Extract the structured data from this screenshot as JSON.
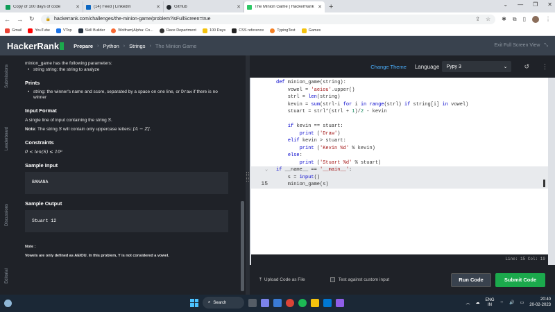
{
  "browser": {
    "tabs": [
      {
        "title": "Copy of 100 days of code",
        "color": "#0f9d58",
        "active": false
      },
      {
        "title": "(14) Feed | LinkedIn",
        "color": "#0a66c2",
        "active": false
      },
      {
        "title": "GitHub",
        "color": "#24292e",
        "active": false
      },
      {
        "title": "The Minion Game | HackerRank",
        "color": "#2ec866",
        "active": true
      }
    ],
    "new_tab": "+",
    "url": "hackerrank.com/challenges/the-minion-game/problem?isFullScreen=true",
    "bookmarks": [
      {
        "label": "Gmail",
        "color": "#ea4335"
      },
      {
        "label": "YouTube",
        "color": "#ff0000"
      },
      {
        "label": "VTop",
        "color": "#1a73e8"
      },
      {
        "label": "Skill Builder",
        "color": "#232f3e"
      },
      {
        "label": "Wolfram|Alpha: Co...",
        "color": "#f96932"
      },
      {
        "label": "Race Department",
        "color": "#333333"
      },
      {
        "label": "100 Days",
        "color": "#f4c20d"
      },
      {
        "label": "CSS reference",
        "color": "#222222"
      },
      {
        "label": "TypingTest",
        "color": "#f48024"
      },
      {
        "label": "Games",
        "color": "#f4c20d"
      }
    ]
  },
  "header": {
    "logo": "HackerRank",
    "crumbs": [
      "Prepare",
      "Python",
      "Strings",
      "The Minion Game"
    ],
    "exit": "Exit Full Screen View"
  },
  "side_tabs": [
    "Submissions",
    "Leaderboard",
    "Discussions",
    "Editorial"
  ],
  "problem": {
    "intro": "minion_game has the following parameters:",
    "param": "string string: the string to analyze",
    "prints_h": "Prints",
    "prints_pre": "string: the winner's name and score, separated by a space on one line, or ",
    "prints_draw": "Draw",
    "prints_post": " if there is no winner",
    "input_h": "Input Format",
    "input_text": "A single line of input containing the string ",
    "input_var": "S.",
    "note_label": "Note",
    "note_text": ": The string ",
    "note_var": "S",
    "note_text2": " will contain only uppercase letters: ",
    "note_range": "[A − Z].",
    "constraints_h": "Constraints",
    "constraint": "0 < len(S) ≤ 10⁶",
    "sample_in_h": "Sample Input",
    "sample_in": "BANANA",
    "sample_out_h": "Sample Output",
    "sample_out": "Stuart 12",
    "footnote_h": "Note :",
    "footnote": "Vowels are only defined as AEIOU. In this problem, Y is not considered a vowel."
  },
  "editor_top": {
    "change_theme": "Change Theme",
    "language_label": "Language",
    "language_value": "Pypy 3"
  },
  "code": {
    "current_line_number": "15",
    "status": "Line: 15 Col: 19"
  },
  "footer": {
    "upload": "Upload Code as File",
    "custom_input": "Test against custom input",
    "run": "Run Code",
    "submit": "Submit Code"
  },
  "taskbar": {
    "search": "Search",
    "lang": "ENG",
    "region": "IN",
    "time": "20:40",
    "date": "20-02-2023"
  }
}
